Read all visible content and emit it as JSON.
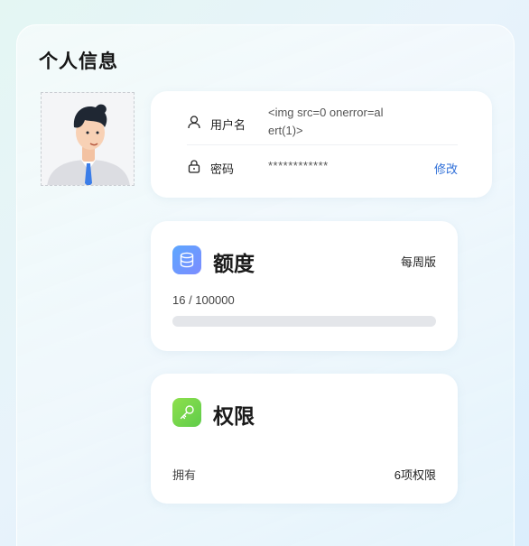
{
  "page": {
    "title": "个人信息"
  },
  "account": {
    "username_label": "用户名",
    "username_value": "<img src=0 onerror=alert(1)>",
    "password_label": "密码",
    "password_value": "************",
    "edit_label": "修改"
  },
  "quota": {
    "title": "额度",
    "plan": "每周版",
    "usage_text": "16 / 100000",
    "used": 16,
    "total": 100000
  },
  "permissions": {
    "title": "权限",
    "label": "拥有",
    "count_text": "6项权限"
  },
  "colors": {
    "accent": "#2f6fd8",
    "quota_icon": "#5da7ff",
    "permission_icon": "#8ee04d",
    "progress_track": "#e4e6ea"
  },
  "icons": {
    "user": "user-icon",
    "lock": "lock-icon",
    "quota": "database-icon",
    "permission": "key-icon"
  }
}
